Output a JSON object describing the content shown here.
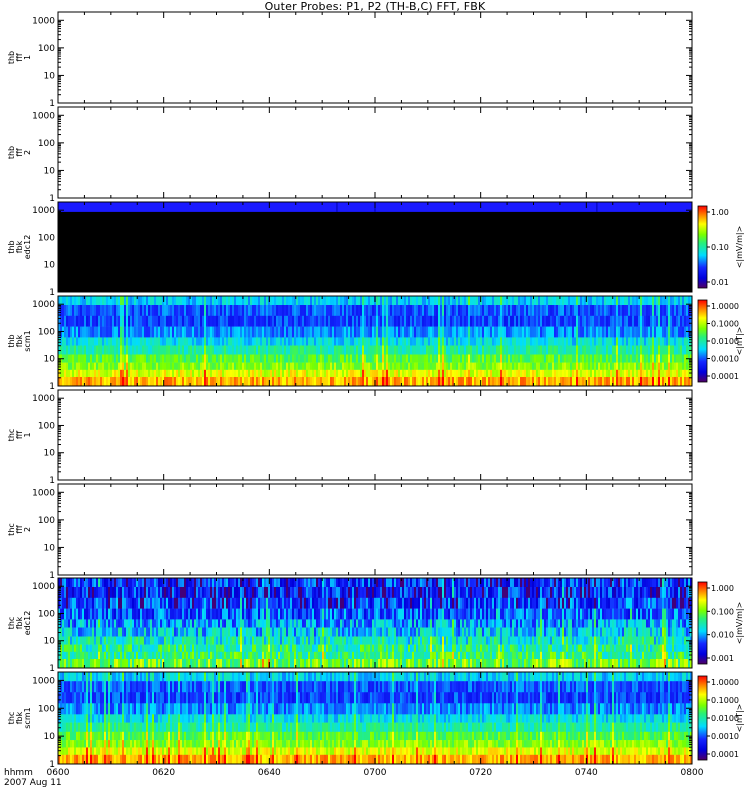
{
  "chart_data": {
    "title": "Outer Probes: P1, P2 (TH-B,C) FFT, FBK",
    "type": "heatmap",
    "x": {
      "ticks": [
        "0600",
        "0620",
        "0640",
        "0700",
        "0720",
        "0740",
        "0800"
      ],
      "label": "hhmm",
      "date": "2007 Aug 11"
    },
    "yticks": [
      "1",
      "10",
      "100",
      "1000"
    ],
    "panels": [
      {
        "probe": "thb",
        "source": "fff",
        "channel": "1",
        "has_data": false,
        "colorbar": null
      },
      {
        "probe": "thb",
        "source": "fff",
        "channel": "2",
        "has_data": false,
        "colorbar": null
      },
      {
        "probe": "thb",
        "source": "fbk",
        "channel": "edc12",
        "has_data": true,
        "pattern": "blue-top-black",
        "colorbar": {
          "label": "<|mV/m|>",
          "ticks": [
            "1.00",
            "0.10",
            "0.01"
          ]
        }
      },
      {
        "probe": "thb",
        "source": "fbk",
        "channel": "scm1",
        "has_data": true,
        "pattern": "scm",
        "colorbar": {
          "label": "<|nT|>",
          "ticks": [
            "1.0000",
            "0.1000",
            "0.0100",
            "0.0010",
            "0.0001"
          ]
        }
      },
      {
        "probe": "thc",
        "source": "fff",
        "channel": "1",
        "has_data": false,
        "colorbar": null
      },
      {
        "probe": "thc",
        "source": "fff",
        "channel": "2",
        "has_data": false,
        "colorbar": null
      },
      {
        "probe": "thc",
        "source": "fbk",
        "channel": "edc12",
        "has_data": true,
        "pattern": "edc",
        "colorbar": {
          "label": "<|mV/m|>",
          "ticks": [
            "1.000",
            "0.100",
            "0.010",
            "0.001"
          ]
        }
      },
      {
        "probe": "thc",
        "source": "fbk",
        "channel": "scm1",
        "has_data": true,
        "pattern": "scm",
        "colorbar": {
          "label": "<|nT|>",
          "ticks": [
            "1.0000",
            "0.1000",
            "0.0100",
            "0.0010",
            "0.0001"
          ]
        }
      }
    ]
  }
}
